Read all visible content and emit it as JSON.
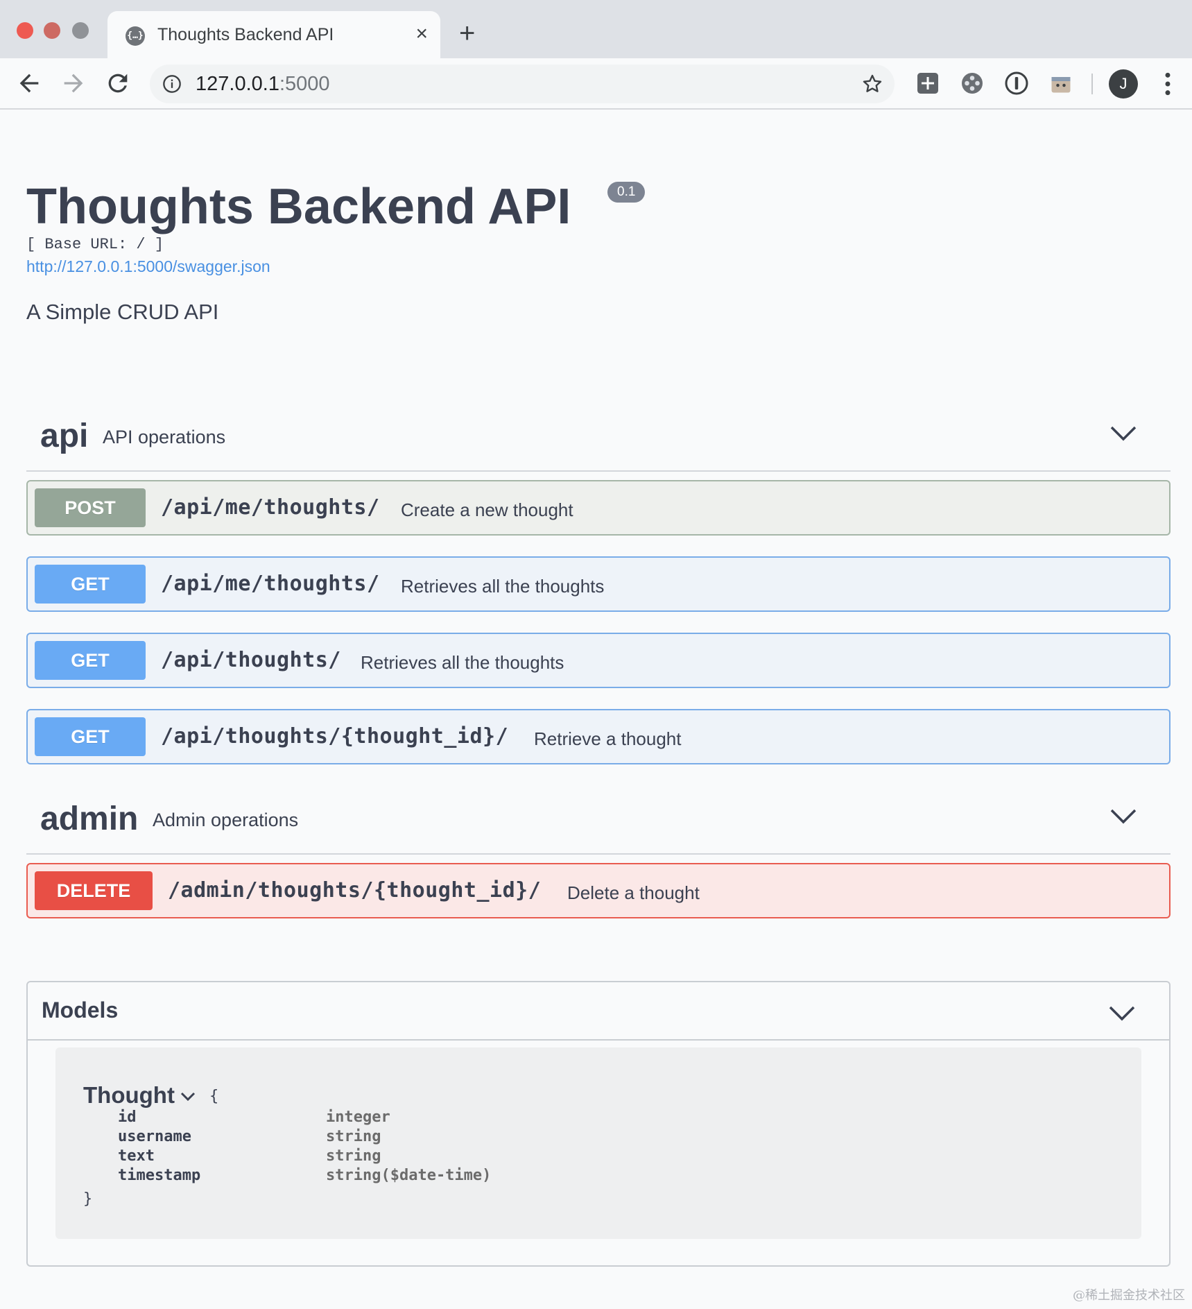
{
  "browser": {
    "tab_title": "Thoughts Backend API",
    "tab_close": "×",
    "new_tab": "+",
    "url_host": "127.0.0.1",
    "url_port": ":5000",
    "avatar_letter": "J"
  },
  "info": {
    "title": "Thoughts Backend API",
    "version": "0.1",
    "base_url": "[ Base URL: / ]",
    "spec_link": "http://127.0.0.1:5000/swagger.json",
    "description": "A Simple CRUD API"
  },
  "tags": [
    {
      "name": "api",
      "description": "API operations",
      "operations": [
        {
          "method": "POST",
          "path": "/api/me/thoughts/",
          "summary": "Create a new thought"
        },
        {
          "method": "GET",
          "path": "/api/me/thoughts/",
          "summary": "Retrieves all the thoughts"
        },
        {
          "method": "GET",
          "path": "/api/thoughts/",
          "summary": "Retrieves all the thoughts"
        },
        {
          "method": "GET",
          "path": "/api/thoughts/{thought_id}/",
          "summary": "Retrieve a thought"
        }
      ]
    },
    {
      "name": "admin",
      "description": "Admin operations",
      "operations": [
        {
          "method": "DELETE",
          "path": "/admin/thoughts/{thought_id}/",
          "summary": "Delete a thought"
        }
      ]
    }
  ],
  "models": {
    "title": "Models",
    "model_name": "Thought",
    "open_brace": "{",
    "close_brace": "}",
    "properties": [
      {
        "name": "id",
        "type": "integer"
      },
      {
        "name": "username",
        "type": "string"
      },
      {
        "name": "text",
        "type": "string"
      },
      {
        "name": "timestamp",
        "type": "string($date-time)"
      }
    ]
  },
  "watermark": "@稀土掘金技术社区",
  "colors": {
    "post": "#95a698",
    "get": "#69aaf4",
    "delete": "#e84f45",
    "link": "#4990e2"
  }
}
